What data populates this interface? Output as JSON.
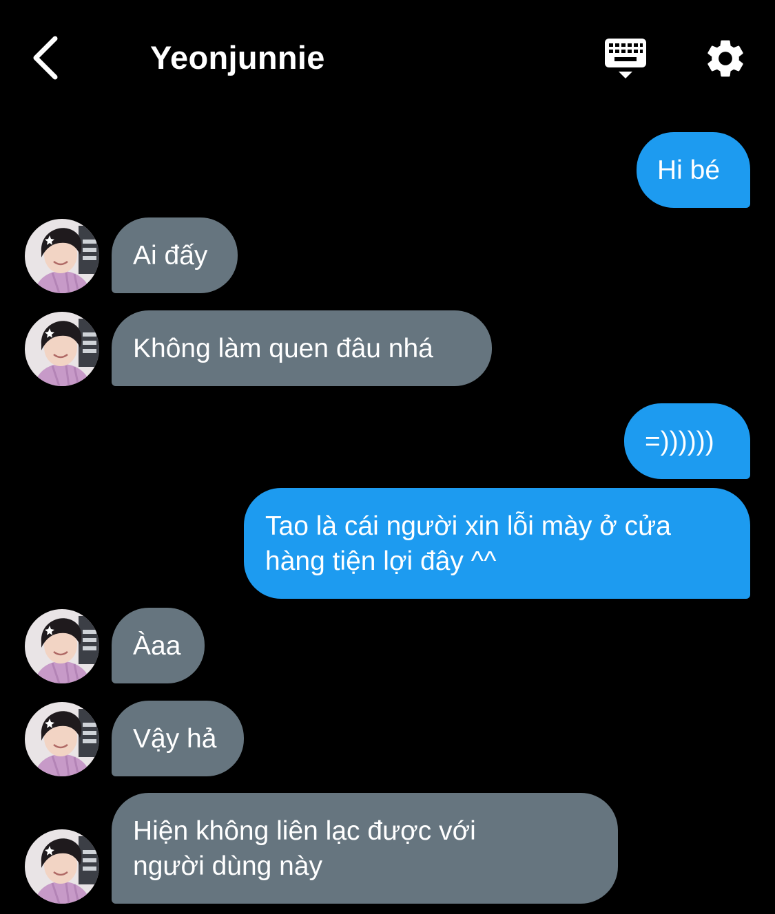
{
  "header": {
    "title": "Yeonjunnie"
  },
  "colors": {
    "background": "#000000",
    "sent_bubble": "#1d9bf0",
    "received_bubble": "#66757f",
    "text": "#ffffff"
  },
  "icons": {
    "back": "chevron-left-icon",
    "keyboard": "keyboard-icon",
    "settings": "gear-icon",
    "avatar": "user-avatar-photo"
  },
  "messages": [
    {
      "sender": "me",
      "text": "Hi bé"
    },
    {
      "sender": "other",
      "text": "Ai đấy"
    },
    {
      "sender": "other",
      "text": "Không làm quen đâu nhá"
    },
    {
      "sender": "me",
      "text": "=))))))"
    },
    {
      "sender": "me",
      "text": "Tao là cái người xin lỗi mày ở cửa\nhàng tiện lợi đây ^^"
    },
    {
      "sender": "other",
      "text": "Àaa"
    },
    {
      "sender": "other",
      "text": "Vậy hả"
    },
    {
      "sender": "other",
      "text": "Hiện không liên lạc được với\nngười dùng này"
    }
  ]
}
